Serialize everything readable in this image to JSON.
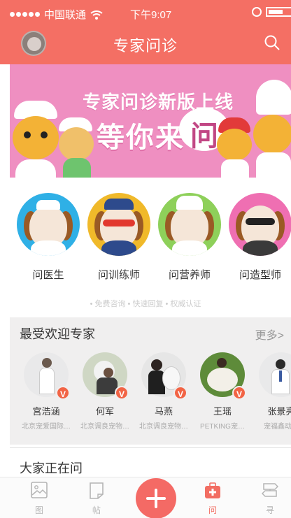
{
  "status_bar": {
    "carrier": "中国联通",
    "time": "下午9:07"
  },
  "header": {
    "title": "专家问诊"
  },
  "banner": {
    "headline": "专家问诊新版上线",
    "sub_prefix": "等你来",
    "sub_char": "问"
  },
  "categories": [
    {
      "label": "问医生",
      "color": "#2fb0e6"
    },
    {
      "label": "问训练师",
      "color": "#f0b92a"
    },
    {
      "label": "问营养师",
      "color": "#8ed05a"
    },
    {
      "label": "问造型师",
      "color": "#ef6fb2"
    }
  ],
  "tagline": "• 免费咨询 • 快速回复 •  权威认证",
  "experts": {
    "title": "最受欢迎专家",
    "more": "更多>",
    "items": [
      {
        "name": "宫浩涵",
        "org": "北京宠爱国际…"
      },
      {
        "name": "何军",
        "org": "北京调良宠物…"
      },
      {
        "name": "马燕",
        "org": "北京调良宠物…"
      },
      {
        "name": "王瑶",
        "org": "PETKING宠…"
      },
      {
        "name": "张景亮",
        "org": "宠福鑫动物"
      }
    ],
    "badge": "V"
  },
  "asking": {
    "title": "大家正在问"
  },
  "tabs": [
    {
      "label": "图",
      "active": false
    },
    {
      "label": "帖",
      "active": false
    },
    {
      "label": "问",
      "active": true
    },
    {
      "label": "寻",
      "active": false
    }
  ],
  "colors": {
    "accent": "#f46f64",
    "banner": "#ef8fc1"
  }
}
